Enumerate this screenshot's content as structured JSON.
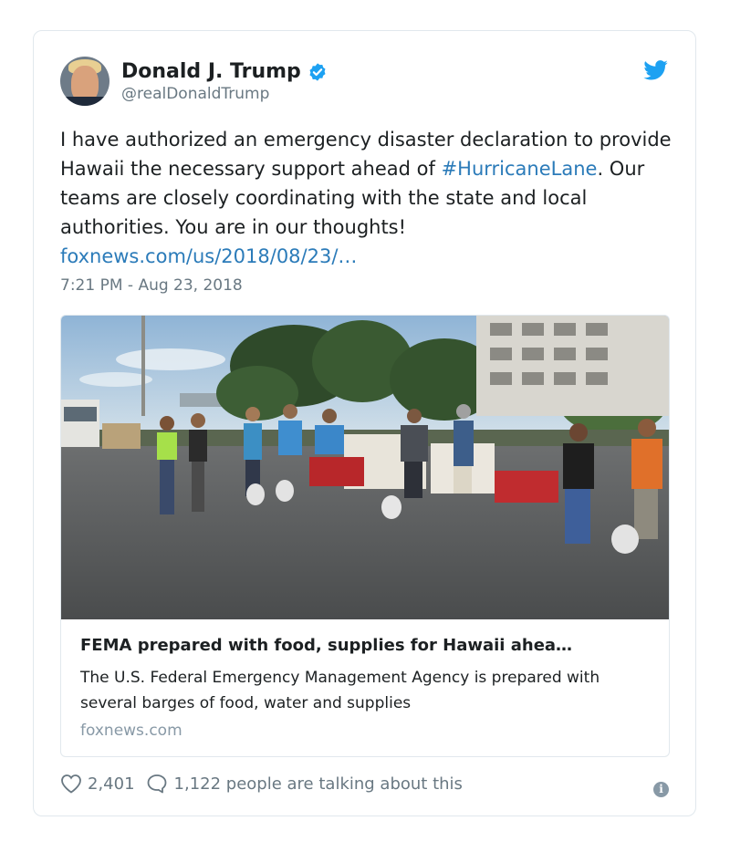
{
  "user": {
    "name": "Donald J. Trump",
    "handle": "@realDonaldTrump"
  },
  "tweet": {
    "text_part1": "I have authorized an emergency disaster declaration to provide Hawaii the necessary support ahead of ",
    "hashtag": "#HurricaneLane",
    "text_part2": ". Our teams are closely coordinating with the state and local authorities. You are in our thoughts! ",
    "link": "foxnews.com/us/2018/08/23/…",
    "timestamp": "7:21 PM - Aug 23, 2018"
  },
  "media_card": {
    "title": "FEMA prepared with food, supplies for Hawaii ahea…",
    "description": "The U.S. Federal Emergency Management Agency is prepared with several barges of food, water and supplies",
    "domain": "foxnews.com"
  },
  "footer": {
    "likes": "2,401",
    "talking": "1,122 people are talking about this"
  },
  "icons": {
    "verified": "verified-badge-icon",
    "twitter": "twitter-bird-icon",
    "like": "heart-icon",
    "reply": "speech-bubble-icon",
    "info": "info-icon"
  },
  "colors": {
    "link": "#2b7bb9",
    "twitter_blue": "#1da1f2",
    "secondary_text": "#697882"
  }
}
